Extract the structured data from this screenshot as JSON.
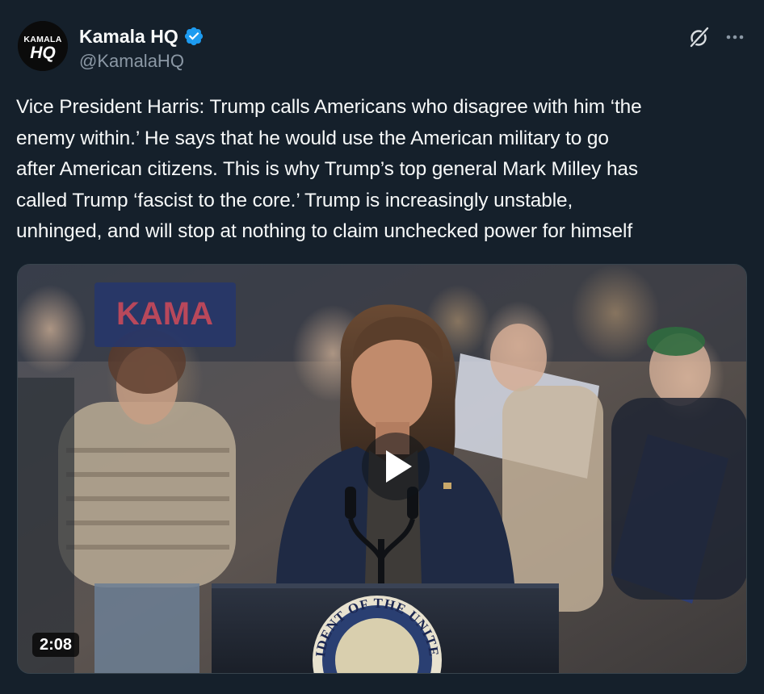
{
  "author": {
    "display_name": "Kamala HQ",
    "handle": "@KamalaHQ",
    "verified": true,
    "avatar_text_top": "KAMALA",
    "avatar_text_bottom": "HQ"
  },
  "icons": {
    "verified": "verified-badge-icon",
    "grok": "grok-icon",
    "more": "more-options-icon",
    "play": "play-icon"
  },
  "tweet": {
    "text": "Vice President Harris: Trump calls Americans who disagree with him ‘the\nenemy within.’ He says that he would use the American military to go\nafter American citizens. This is why Trump’s top general Mark Milley has\ncalled Trump ‘fascist to the core.’ Trump is increasingly unstable,\nunhinged, and will stop at nothing to claim unchecked power for himself"
  },
  "media": {
    "type": "video",
    "duration": "2:08",
    "seal_text": "IDENT OF THE UNITE",
    "sign_text": "KAMA"
  },
  "colors": {
    "background": "#15202b",
    "text": "#f7f9f9",
    "secondary_text": "#8b98a5",
    "verified_blue": "#1d9bf0"
  }
}
